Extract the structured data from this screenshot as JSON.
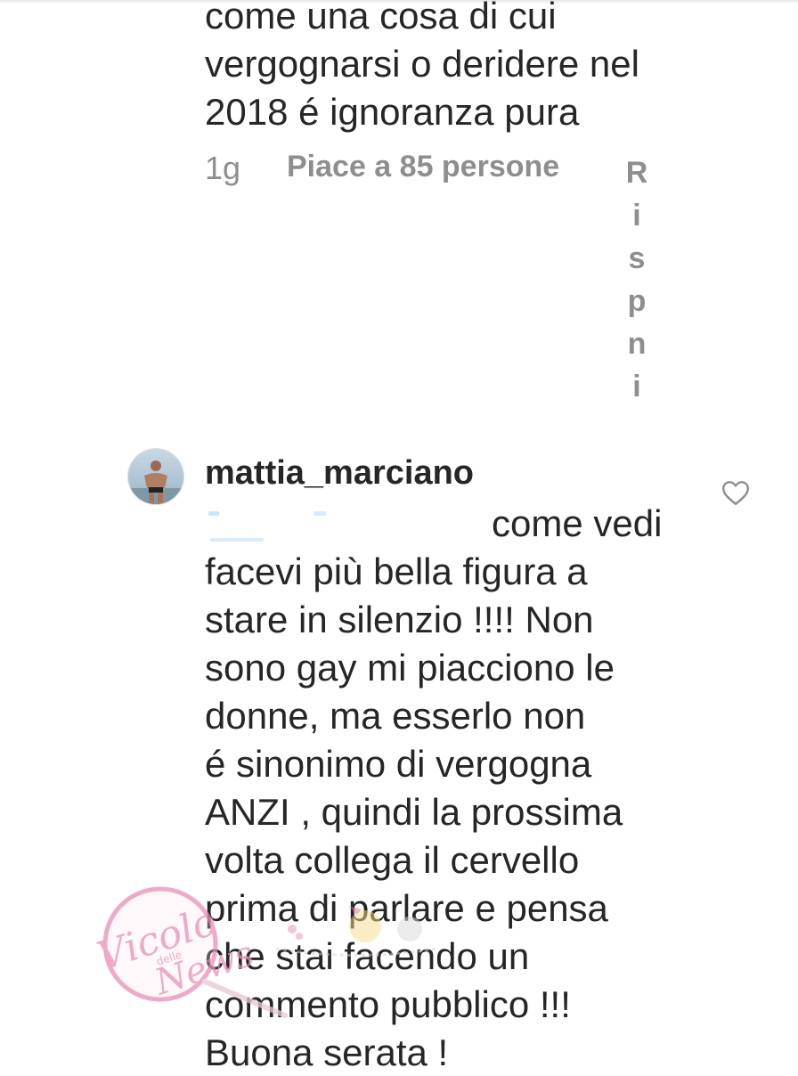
{
  "previous_comment": {
    "lines": [
      "come una cosa di cui",
      "vergognarsi o deridere nel",
      "2018 é ignoranza pura"
    ],
    "time": "1g",
    "likes": "Piace a 85 persone",
    "reply_letters": [
      "R",
      "i",
      "s",
      "p",
      "n",
      "i"
    ]
  },
  "comment": {
    "username": "mattia_marciano",
    "first_line_after_mention": "come vedi",
    "lines": [
      "facevi più bella figura a",
      "stare in silenzio !!!! Non",
      "sono gay mi piacciono le",
      "donne, ma esserlo non",
      "é sinonimo di vergogna",
      "ANZI , quindi la prossima",
      "volta collega il cervello",
      "prima di parlare e pensa",
      "che stai facendo un",
      "commento pubblico !!!",
      "Buona serata !"
    ],
    "like_icon": "heart-outline-icon"
  },
  "watermark": {
    "text": "Vicolo delle News",
    "color": "#e88fb8"
  },
  "colors": {
    "text": "#262626",
    "meta": "#8e8e8e",
    "mention_blur": "#3897f0"
  }
}
